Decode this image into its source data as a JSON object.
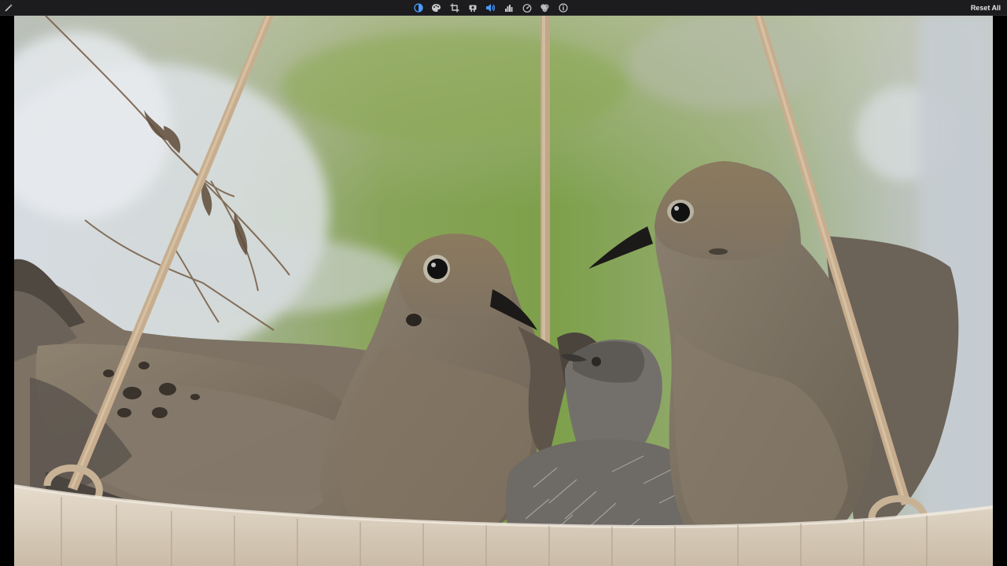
{
  "toolbar": {
    "tools": [
      {
        "icon": "magic-wand-icon"
      },
      {
        "icon": "contrast-circle-icon",
        "active": true
      },
      {
        "icon": "palette-icon"
      },
      {
        "icon": "crop-icon"
      },
      {
        "icon": "projector-icon"
      },
      {
        "icon": "speaker-icon",
        "active": true
      },
      {
        "icon": "histogram-icon"
      },
      {
        "icon": "speed-gauge-icon"
      },
      {
        "icon": "filters-icon"
      },
      {
        "icon": "info-icon"
      }
    ],
    "reset_label": "Reset All"
  },
  "colors": {
    "toolbar_bg": "#1c1c1e",
    "icon": "#c8c8cc",
    "accent": "#4a9bff"
  }
}
